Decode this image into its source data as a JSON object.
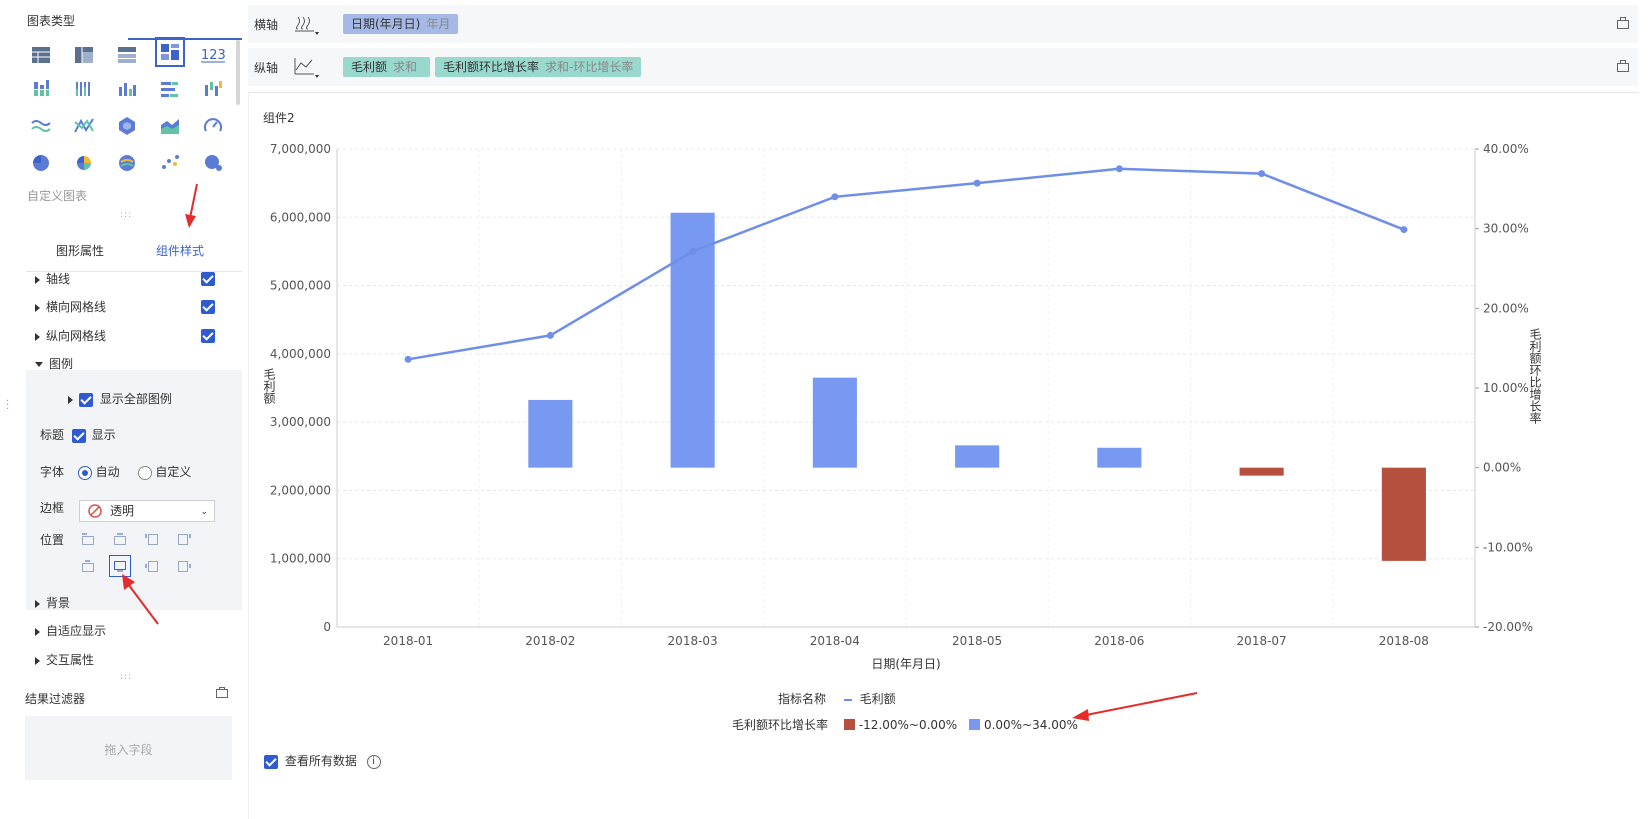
{
  "left_panel": {
    "chart_type_title": "图表类型",
    "custom_chart_label": "自定义图表",
    "tabs": [
      "图形属性",
      "组件样式"
    ],
    "active_tab_index": 1,
    "style_items": [
      {
        "label": "轴线",
        "checked": true
      },
      {
        "label": "横向网格线",
        "checked": true
      },
      {
        "label": "纵向网格线",
        "checked": true
      }
    ],
    "legend_section": {
      "label": "图例",
      "show_all_label": "显示全部图例",
      "title_label": "标题",
      "title_show_label": "显示",
      "font_label": "字体",
      "font_options": [
        "自动",
        "自定义"
      ],
      "font_selected": "自动",
      "border_label": "边框",
      "border_value": "透明",
      "position_label": "位置"
    },
    "more_sections": [
      "背景",
      "自适应显示",
      "交互属性"
    ],
    "filter": {
      "title": "结果过滤器",
      "placeholder": "拖入字段"
    }
  },
  "axes": {
    "x_label": "横轴",
    "x_field": {
      "name": "日期(年月日)",
      "sub": "年月"
    },
    "y_label": "纵轴",
    "y_fields": [
      {
        "name": "毛利额",
        "sub": "求和"
      },
      {
        "name": "毛利额环比增长率",
        "sub": "求和-环比增长率"
      }
    ]
  },
  "component_title": "组件2",
  "legend": {
    "metric_title": "指标名称",
    "metric_item": "毛利额",
    "rate_title": "毛利额环比增长率",
    "ranges": [
      "-12.00%~0.00%",
      "0.00%~34.00%"
    ]
  },
  "footer": {
    "show_all_data_label": "查看所有数据",
    "info_symbol": "i"
  },
  "colors": {
    "accent": "#3b63c9",
    "bar_positive": "#7799f1",
    "bar_negative": "#b5503f",
    "line": "#6f8ee8"
  },
  "chart_data": {
    "type": "bar",
    "categories": [
      "2018-01",
      "2018-02",
      "2018-03",
      "2018-04",
      "2018-05",
      "2018-06",
      "2018-07",
      "2018-08"
    ],
    "xlabel": "日期(年月日)",
    "ylabel": "毛利额",
    "y2label": "毛利额环比增长率",
    "ylim": [
      0,
      7000000
    ],
    "yticks": [
      "0",
      "1,000,000",
      "2,000,000",
      "3,000,000",
      "4,000,000",
      "5,000,000",
      "6,000,000",
      "7,000,000"
    ],
    "y2lim": [
      -20,
      40
    ],
    "y2ticks": [
      "-20.00%",
      "-10.00%",
      "0.00%",
      "10.00%",
      "20.00%",
      "30.00%",
      "40.00%"
    ],
    "series": [
      {
        "name": "毛利额环比增长率",
        "kind": "bar",
        "axis": "right",
        "values": [
          null,
          8.5,
          32.0,
          11.3,
          2.8,
          2.5,
          -1.0,
          -11.7
        ]
      },
      {
        "name": "毛利额",
        "kind": "line",
        "axis": "left",
        "values": [
          3920000,
          4270000,
          5500000,
          6300000,
          6500000,
          6710000,
          6640000,
          5820000
        ]
      }
    ],
    "grid": true
  }
}
